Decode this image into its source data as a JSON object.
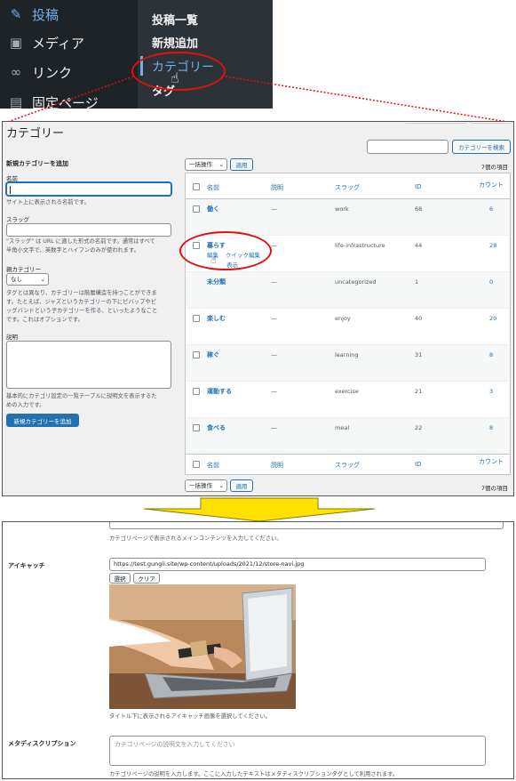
{
  "admin_menu": {
    "items": [
      {
        "label": "投稿",
        "icon": "pin-icon"
      },
      {
        "label": "メディア",
        "icon": "media-icon"
      },
      {
        "label": "リンク",
        "icon": "link-icon"
      },
      {
        "label": "固定ページ",
        "icon": "page-icon"
      }
    ],
    "submenu": [
      "投稿一覧",
      "新規追加",
      "カテゴリー",
      "タグ"
    ]
  },
  "page": {
    "title": "カテゴリー",
    "search_button": "カテゴリーを検索",
    "add_form": {
      "heading": "新規カテゴリーを追加",
      "name_label": "名前",
      "name_hint": "サイト上に表示される名前です。",
      "slug_label": "スラッグ",
      "slug_hint_1": "\"スラッグ\" は URL に適した形式の名前です。通常はすべて",
      "slug_hint_2": "半角小文字で、英数字とハイフンのみが使われます。",
      "parent_label": "親カテゴリー",
      "parent_value": "なし",
      "parent_hint_1": "タグとは異なり、カテゴリーは階層構造を持つことができま",
      "parent_hint_2": "す。たとえば、ジャズというカテゴリーの下にビバップやビ",
      "parent_hint_3": "ッグバンドという子カテゴリーを作る、といったようなこと",
      "parent_hint_4": "です。これはオプションです。",
      "desc_label": "説明",
      "desc_hint_1": "基本的にカテゴリ設定の一覧テーブルに説明文を表示するた",
      "desc_hint_2": "めの入力です。",
      "submit": "新規カテゴリーを追加"
    },
    "bulk_action": "一括操作",
    "apply": "適用",
    "item_count": "7個の項目",
    "columns": {
      "name": "名前",
      "desc": "説明",
      "slug": "スラッグ",
      "id": "ID",
      "count": "カウント"
    },
    "rows": [
      {
        "name": "働く",
        "desc": "—",
        "slug": "work",
        "id": "68",
        "count": "6"
      },
      {
        "name": "暮らす",
        "desc": "—",
        "slug": "life-infrastructure",
        "id": "44",
        "count": "28"
      },
      {
        "name": "未分類",
        "desc": "—",
        "slug": "uncategorized",
        "id": "1",
        "count": "0"
      },
      {
        "name": "楽しむ",
        "desc": "—",
        "slug": "enjoy",
        "id": "40",
        "count": "20"
      },
      {
        "name": "稼ぐ",
        "desc": "—",
        "slug": "learning",
        "id": "31",
        "count": "8"
      },
      {
        "name": "運動する",
        "desc": "—",
        "slug": "exercise",
        "id": "21",
        "count": "3"
      },
      {
        "name": "食べる",
        "desc": "—",
        "slug": "meal",
        "id": "22",
        "count": "8"
      }
    ],
    "row_actions": {
      "edit": "編集",
      "quick_edit": "クイック編集",
      "view": "表示"
    }
  },
  "detail": {
    "content_hint": "カテゴリページで表示されるメインコンテンツを入力してください。",
    "eyecatch_label": "アイキャッチ",
    "eyecatch_url": "https://test.gungii.site/wp-content/uploads/2021/12/store-navi.jpg",
    "select_btn": "選択",
    "clear_btn": "クリア",
    "eyecatch_hint": "タイトル下に表示されるアイキャッチ画像を選択してください。",
    "meta_label": "メタディスクリプション",
    "meta_placeholder": "カテゴリページの説明文を入力してください",
    "meta_hint": "カテゴリページの説明を入力します。ここに入力したテキストはメタディスクリプションタグとして利用されます。"
  },
  "colors": {
    "accent": "#2271b1",
    "highlight": "#e01010",
    "arrow": "#ffe100"
  }
}
